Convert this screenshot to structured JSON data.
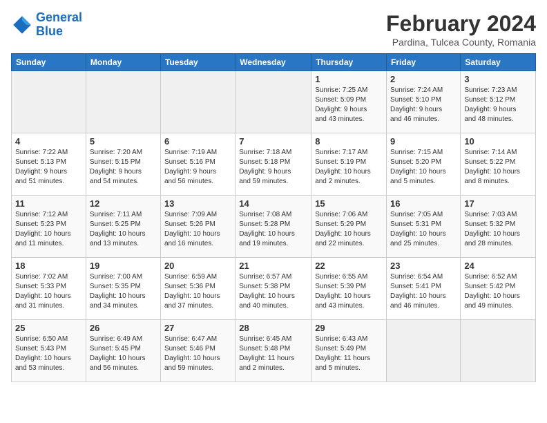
{
  "header": {
    "logo_line1": "General",
    "logo_line2": "Blue",
    "month_year": "February 2024",
    "location": "Pardina, Tulcea County, Romania"
  },
  "days_of_week": [
    "Sunday",
    "Monday",
    "Tuesday",
    "Wednesday",
    "Thursday",
    "Friday",
    "Saturday"
  ],
  "weeks": [
    [
      {
        "day": "",
        "info": ""
      },
      {
        "day": "",
        "info": ""
      },
      {
        "day": "",
        "info": ""
      },
      {
        "day": "",
        "info": ""
      },
      {
        "day": "1",
        "info": "Sunrise: 7:25 AM\nSunset: 5:09 PM\nDaylight: 9 hours\nand 43 minutes."
      },
      {
        "day": "2",
        "info": "Sunrise: 7:24 AM\nSunset: 5:10 PM\nDaylight: 9 hours\nand 46 minutes."
      },
      {
        "day": "3",
        "info": "Sunrise: 7:23 AM\nSunset: 5:12 PM\nDaylight: 9 hours\nand 48 minutes."
      }
    ],
    [
      {
        "day": "4",
        "info": "Sunrise: 7:22 AM\nSunset: 5:13 PM\nDaylight: 9 hours\nand 51 minutes."
      },
      {
        "day": "5",
        "info": "Sunrise: 7:20 AM\nSunset: 5:15 PM\nDaylight: 9 hours\nand 54 minutes."
      },
      {
        "day": "6",
        "info": "Sunrise: 7:19 AM\nSunset: 5:16 PM\nDaylight: 9 hours\nand 56 minutes."
      },
      {
        "day": "7",
        "info": "Sunrise: 7:18 AM\nSunset: 5:18 PM\nDaylight: 9 hours\nand 59 minutes."
      },
      {
        "day": "8",
        "info": "Sunrise: 7:17 AM\nSunset: 5:19 PM\nDaylight: 10 hours\nand 2 minutes."
      },
      {
        "day": "9",
        "info": "Sunrise: 7:15 AM\nSunset: 5:20 PM\nDaylight: 10 hours\nand 5 minutes."
      },
      {
        "day": "10",
        "info": "Sunrise: 7:14 AM\nSunset: 5:22 PM\nDaylight: 10 hours\nand 8 minutes."
      }
    ],
    [
      {
        "day": "11",
        "info": "Sunrise: 7:12 AM\nSunset: 5:23 PM\nDaylight: 10 hours\nand 11 minutes."
      },
      {
        "day": "12",
        "info": "Sunrise: 7:11 AM\nSunset: 5:25 PM\nDaylight: 10 hours\nand 13 minutes."
      },
      {
        "day": "13",
        "info": "Sunrise: 7:09 AM\nSunset: 5:26 PM\nDaylight: 10 hours\nand 16 minutes."
      },
      {
        "day": "14",
        "info": "Sunrise: 7:08 AM\nSunset: 5:28 PM\nDaylight: 10 hours\nand 19 minutes."
      },
      {
        "day": "15",
        "info": "Sunrise: 7:06 AM\nSunset: 5:29 PM\nDaylight: 10 hours\nand 22 minutes."
      },
      {
        "day": "16",
        "info": "Sunrise: 7:05 AM\nSunset: 5:31 PM\nDaylight: 10 hours\nand 25 minutes."
      },
      {
        "day": "17",
        "info": "Sunrise: 7:03 AM\nSunset: 5:32 PM\nDaylight: 10 hours\nand 28 minutes."
      }
    ],
    [
      {
        "day": "18",
        "info": "Sunrise: 7:02 AM\nSunset: 5:33 PM\nDaylight: 10 hours\nand 31 minutes."
      },
      {
        "day": "19",
        "info": "Sunrise: 7:00 AM\nSunset: 5:35 PM\nDaylight: 10 hours\nand 34 minutes."
      },
      {
        "day": "20",
        "info": "Sunrise: 6:59 AM\nSunset: 5:36 PM\nDaylight: 10 hours\nand 37 minutes."
      },
      {
        "day": "21",
        "info": "Sunrise: 6:57 AM\nSunset: 5:38 PM\nDaylight: 10 hours\nand 40 minutes."
      },
      {
        "day": "22",
        "info": "Sunrise: 6:55 AM\nSunset: 5:39 PM\nDaylight: 10 hours\nand 43 minutes."
      },
      {
        "day": "23",
        "info": "Sunrise: 6:54 AM\nSunset: 5:41 PM\nDaylight: 10 hours\nand 46 minutes."
      },
      {
        "day": "24",
        "info": "Sunrise: 6:52 AM\nSunset: 5:42 PM\nDaylight: 10 hours\nand 49 minutes."
      }
    ],
    [
      {
        "day": "25",
        "info": "Sunrise: 6:50 AM\nSunset: 5:43 PM\nDaylight: 10 hours\nand 53 minutes."
      },
      {
        "day": "26",
        "info": "Sunrise: 6:49 AM\nSunset: 5:45 PM\nDaylight: 10 hours\nand 56 minutes."
      },
      {
        "day": "27",
        "info": "Sunrise: 6:47 AM\nSunset: 5:46 PM\nDaylight: 10 hours\nand 59 minutes."
      },
      {
        "day": "28",
        "info": "Sunrise: 6:45 AM\nSunset: 5:48 PM\nDaylight: 11 hours\nand 2 minutes."
      },
      {
        "day": "29",
        "info": "Sunrise: 6:43 AM\nSunset: 5:49 PM\nDaylight: 11 hours\nand 5 minutes."
      },
      {
        "day": "",
        "info": ""
      },
      {
        "day": "",
        "info": ""
      }
    ]
  ]
}
